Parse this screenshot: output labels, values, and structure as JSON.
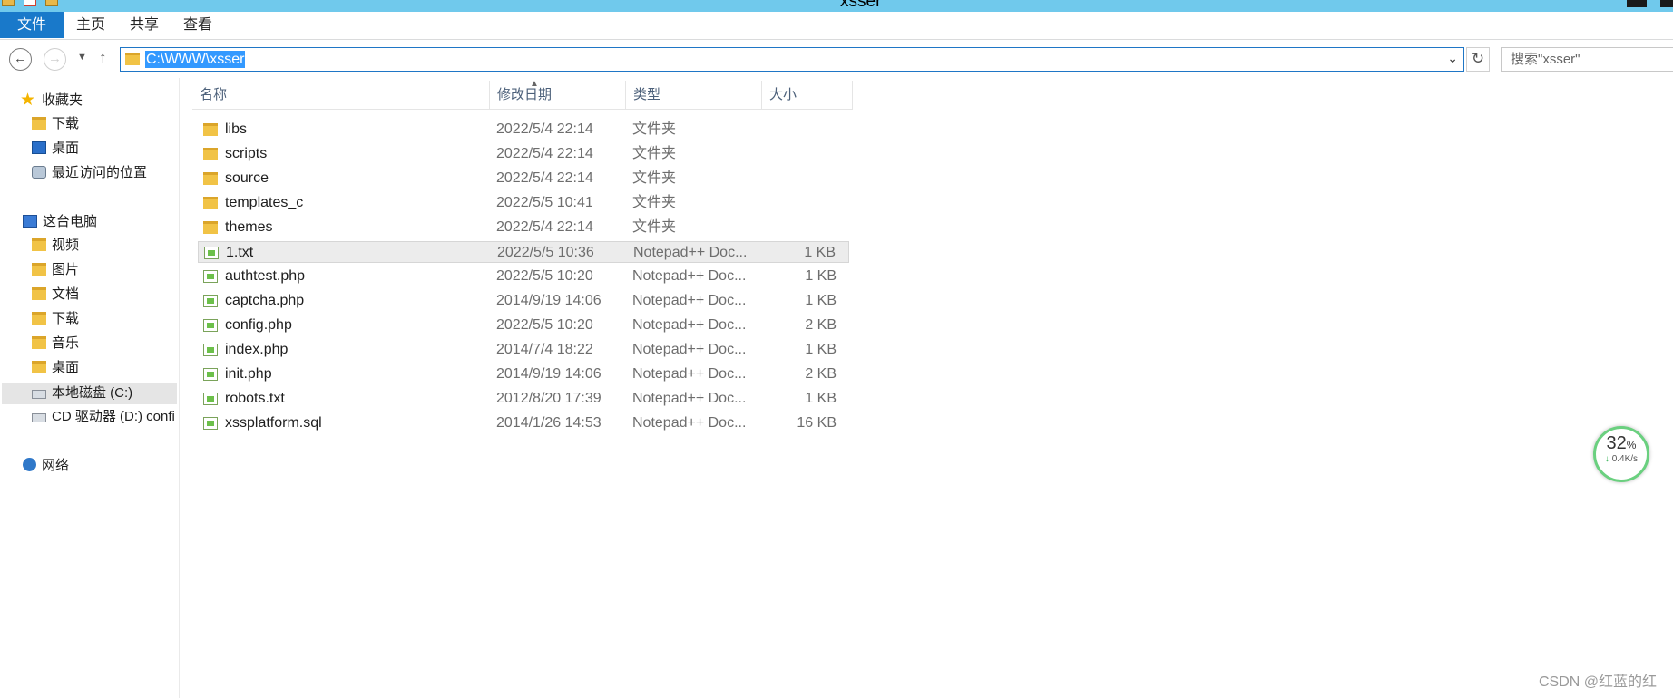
{
  "window": {
    "title": "xsser"
  },
  "ribbon": {
    "tabs": [
      "文件",
      "主页",
      "共享",
      "查看"
    ]
  },
  "address": {
    "path": "C:\\WWW\\xsser"
  },
  "search": {
    "placeholder": "搜索\"xsser\""
  },
  "nav": {
    "favorites_label": "收藏夹",
    "favorites": [
      "下载",
      "桌面",
      "最近访问的位置"
    ],
    "pc_label": "这台电脑",
    "pc_items": [
      "视频",
      "图片",
      "文档",
      "下载",
      "音乐",
      "桌面",
      "本地磁盘 (C:)",
      "CD 驱动器 (D:) confi"
    ],
    "network_label": "网络"
  },
  "columns": {
    "name": "名称",
    "date": "修改日期",
    "type": "类型",
    "size": "大小"
  },
  "files": [
    {
      "name": "libs",
      "date": "2022/5/4 22:14",
      "type": "文件夹",
      "size": "",
      "kind": "folder"
    },
    {
      "name": "scripts",
      "date": "2022/5/4 22:14",
      "type": "文件夹",
      "size": "",
      "kind": "folder"
    },
    {
      "name": "source",
      "date": "2022/5/4 22:14",
      "type": "文件夹",
      "size": "",
      "kind": "folder"
    },
    {
      "name": "templates_c",
      "date": "2022/5/5 10:41",
      "type": "文件夹",
      "size": "",
      "kind": "folder"
    },
    {
      "name": "themes",
      "date": "2022/5/4 22:14",
      "type": "文件夹",
      "size": "",
      "kind": "folder"
    },
    {
      "name": "1.txt",
      "date": "2022/5/5 10:36",
      "type": "Notepad++ Doc...",
      "size": "1 KB",
      "kind": "file",
      "selected": true
    },
    {
      "name": "authtest.php",
      "date": "2022/5/5 10:20",
      "type": "Notepad++ Doc...",
      "size": "1 KB",
      "kind": "file"
    },
    {
      "name": "captcha.php",
      "date": "2014/9/19 14:06",
      "type": "Notepad++ Doc...",
      "size": "1 KB",
      "kind": "file"
    },
    {
      "name": "config.php",
      "date": "2022/5/5 10:20",
      "type": "Notepad++ Doc...",
      "size": "2 KB",
      "kind": "file"
    },
    {
      "name": "index.php",
      "date": "2014/7/4 18:22",
      "type": "Notepad++ Doc...",
      "size": "1 KB",
      "kind": "file"
    },
    {
      "name": "init.php",
      "date": "2014/9/19 14:06",
      "type": "Notepad++ Doc...",
      "size": "2 KB",
      "kind": "file"
    },
    {
      "name": "robots.txt",
      "date": "2012/8/20 17:39",
      "type": "Notepad++ Doc...",
      "size": "1 KB",
      "kind": "file"
    },
    {
      "name": "xssplatform.sql",
      "date": "2014/1/26 14:53",
      "type": "Notepad++ Doc...",
      "size": "16 KB",
      "kind": "file"
    }
  ],
  "network_widget": {
    "percent": "32",
    "unit": "%",
    "speed": "0.4K/s"
  },
  "watermark": "CSDN @红蓝的红"
}
